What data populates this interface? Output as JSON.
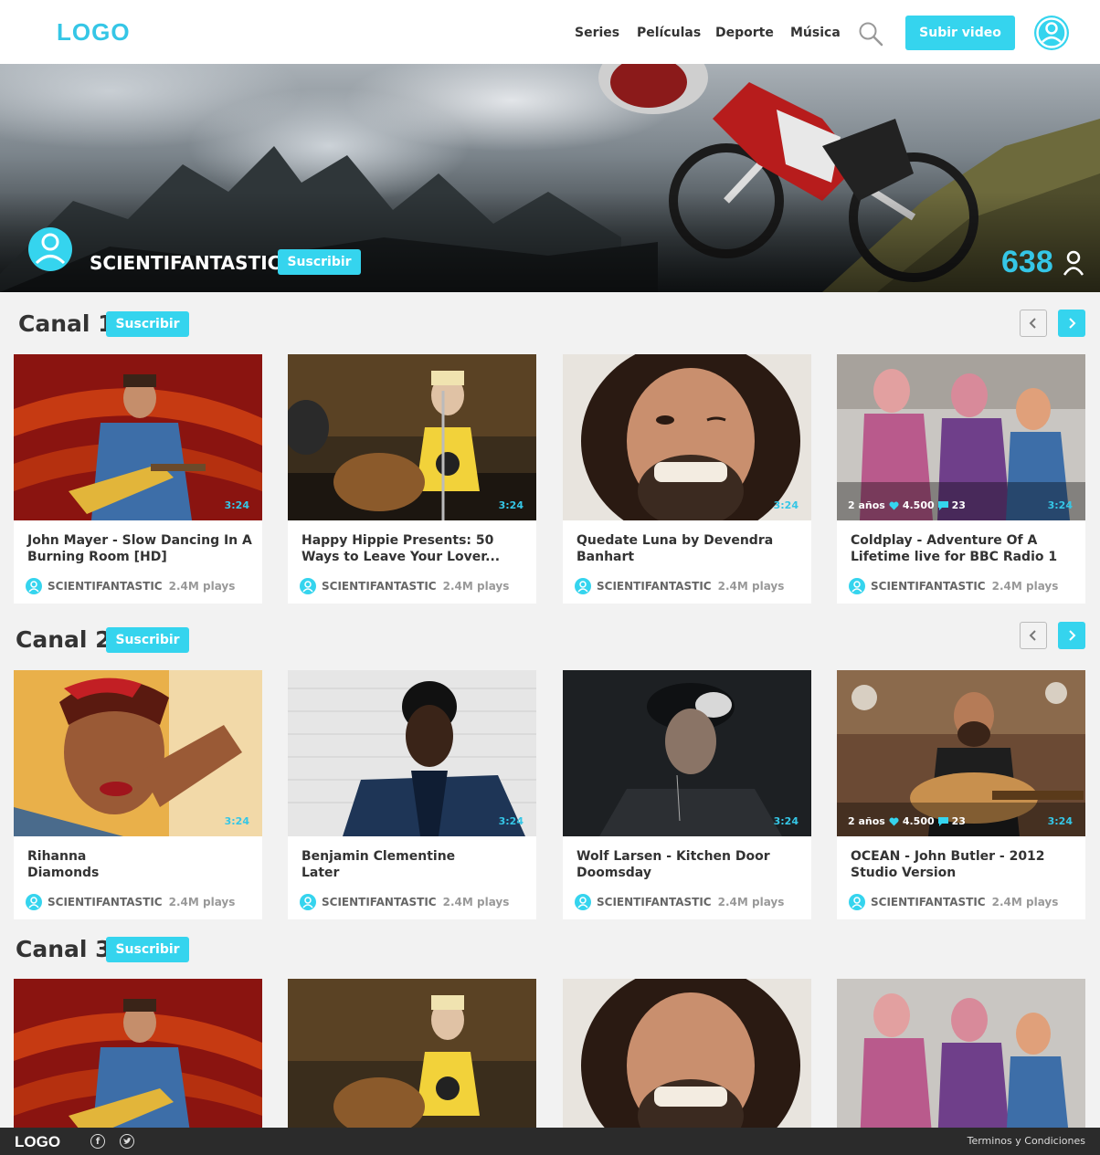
{
  "header": {
    "logo": "LOGO",
    "nav": [
      "Series",
      "Películas",
      "Deporte",
      "Música"
    ],
    "upload_label": "Subir video"
  },
  "banner": {
    "channel_name": "SCIENTIFANTASTIC",
    "subscribe_label": "Suscribir",
    "subscriber_count": "638"
  },
  "sections": [
    {
      "title": "Canal 1",
      "subscribe_label": "Suscribir",
      "cards": [
        {
          "title": "John Mayer - Slow Dancing In A Burning Room [HD]",
          "duration": "3:24",
          "channel": "SCIENTIFANTASTIC",
          "plays": "2.4M plays"
        },
        {
          "title": "Happy Hippie Presents: 50 Ways to Leave Your Lover...",
          "duration": "3:24",
          "channel": "SCIENTIFANTASTIC",
          "plays": "2.4M plays"
        },
        {
          "title": "Quedate Luna by Devendra Banhart",
          "duration": "3:24",
          "channel": "SCIENTIFANTASTIC",
          "plays": "2.4M plays"
        },
        {
          "title": "Coldplay - Adventure Of A Lifetime live for BBC Radio 1",
          "duration": "3:24",
          "age": "2 años",
          "likes": "4.500",
          "comments": "23",
          "channel": "SCIENTIFANTASTIC",
          "plays": "2.4M plays"
        }
      ]
    },
    {
      "title": "Canal 2",
      "subscribe_label": "Suscribir",
      "cards": [
        {
          "title_line1": "Rihanna",
          "title_line2": "Diamonds",
          "duration": "3:24",
          "channel": "SCIENTIFANTASTIC",
          "plays": "2.4M plays"
        },
        {
          "title_line1": "Benjamin Clementine",
          "title_line2": "Later",
          "duration": "3:24",
          "channel": "SCIENTIFANTASTIC",
          "plays": "2.4M plays"
        },
        {
          "title_line1": "Wolf Larsen - Kitchen Door",
          "title_line2": "Doomsday",
          "duration": "3:24",
          "channel": "SCIENTIFANTASTIC",
          "plays": "2.4M plays"
        },
        {
          "title_line1": "OCEAN - John Butler - 2012",
          "title_line2": "Studio Version",
          "duration": "3:24",
          "age": "2 años",
          "likes": "4.500",
          "comments": "23",
          "channel": "SCIENTIFANTASTIC",
          "plays": "2.4M plays"
        }
      ]
    },
    {
      "title": "Canal 3",
      "subscribe_label": "Suscribir"
    }
  ],
  "footer": {
    "logo": "LOGO",
    "terms": "Terminos y Condiciones"
  },
  "colors": {
    "accent": "#35d4ee",
    "accent_text": "#35c6e6",
    "footer_bg": "#2b2b2b",
    "page_bg": "#f2f2f2"
  },
  "icons": [
    "search-icon",
    "user-avatar-icon",
    "person-icon",
    "chevron-left-icon",
    "chevron-right-icon",
    "heart-icon",
    "comment-icon",
    "facebook-icon",
    "twitter-icon"
  ]
}
